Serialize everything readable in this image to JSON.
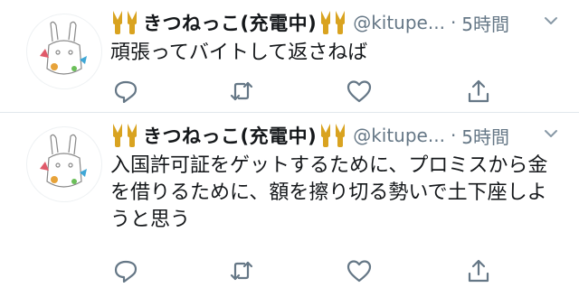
{
  "tweets": [
    {
      "display_name": "きつねっこ(充電中)",
      "handle": "@kitupe...",
      "separator": "·",
      "time": "5時間",
      "text": "頑張ってバイトして返さねば"
    },
    {
      "display_name": "きつねっこ(充電中)",
      "handle": "@kitupe...",
      "separator": "·",
      "time": "5時間",
      "text": "入国許可証をゲットするために、プロミスから金を借りるために、額を擦り切る勢いで土下座しようと思う"
    }
  ],
  "icons": {
    "name_emoji": "fox-emoji-icon",
    "menu": "chevron-down-icon",
    "reply": "reply-icon",
    "retweet": "retweet-icon",
    "like": "heart-icon",
    "share": "share-icon"
  },
  "colors": {
    "icon": "#657786",
    "divider": "#e1e8ed",
    "emoji": "#d9a320",
    "text": "#14171a"
  }
}
